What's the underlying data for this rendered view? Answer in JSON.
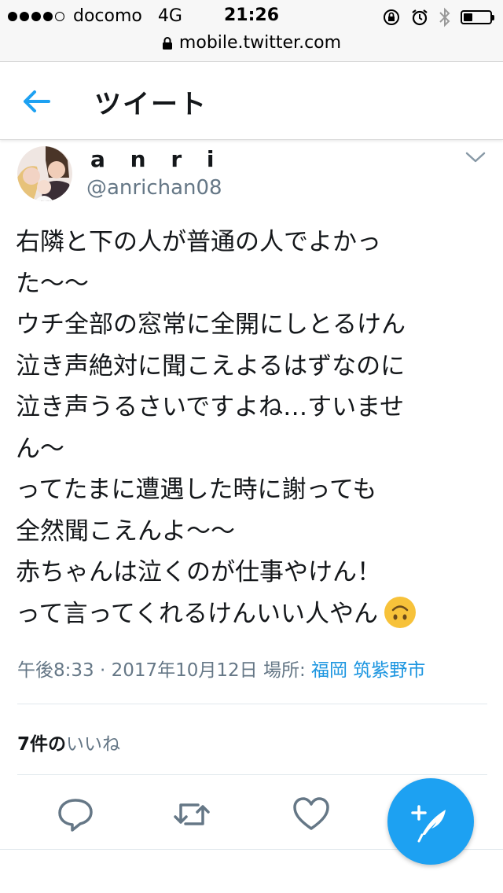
{
  "status_bar": {
    "carrier": "docomo",
    "network": "4G",
    "time": "21:26",
    "signal_bars_filled": 4,
    "signal_bars_total": 5,
    "battery_level": 0.35
  },
  "browser": {
    "url": "mobile.twitter.com",
    "lock_icon": "lock-icon"
  },
  "header": {
    "title": "ツイート",
    "back_icon": "arrow-left-icon"
  },
  "tweet": {
    "display_name": "a n r i",
    "handle": "@anrichan08",
    "text_lines": [
      "右隣と下の人が普通の人でよかっ",
      "た〜〜",
      "ウチ全部の窓常に全開にしとるけん",
      "泣き声絶対に聞こえよるはずなのに",
      "泣き声うるさいですよね…すいませ",
      "ん〜",
      "ってたまに遭遇した時に謝っても",
      "全然聞こえんよ〜〜",
      "赤ちゃんは泣くのが仕事やけん！",
      "って言ってくれるけんいい人やん"
    ],
    "emoji": "upside-down-face-emoji",
    "timestamp": "午後8:33 · 2017年10月12日",
    "location_label": "場所:",
    "location": "福岡 筑紫野市",
    "likes_count": "7件の",
    "likes_label": "いいね"
  },
  "actions": {
    "reply_icon": "reply-icon",
    "retweet_icon": "retweet-icon",
    "like_icon": "heart-icon",
    "compose_icon": "compose-tweet-icon"
  },
  "colors": {
    "accent": "#1da1f2",
    "link": "#1b95e0",
    "secondary_text": "#657786"
  }
}
